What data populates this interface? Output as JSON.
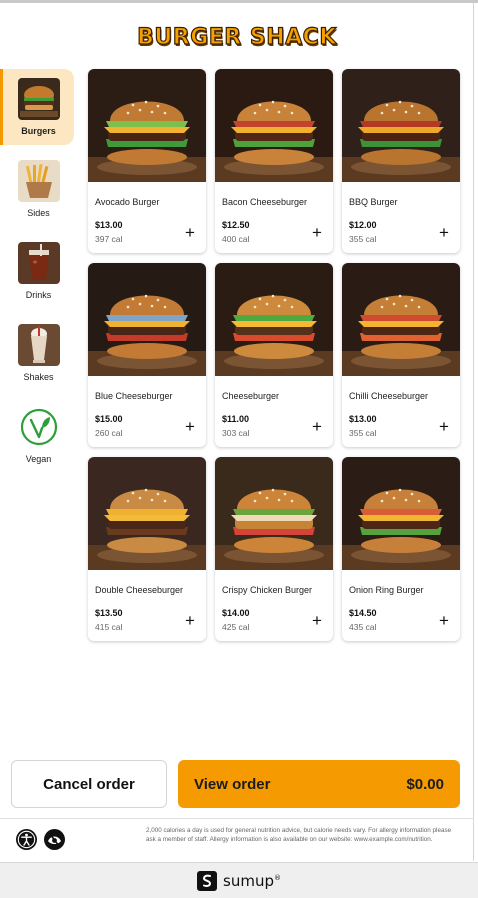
{
  "brand": {
    "title": "BURGER SHACK"
  },
  "categories": [
    {
      "label": "Burgers",
      "icon": "burger-icon",
      "active": true
    },
    {
      "label": "Sides",
      "icon": "fries-icon",
      "active": false
    },
    {
      "label": "Drinks",
      "icon": "drink-icon",
      "active": false
    },
    {
      "label": "Shakes",
      "icon": "shake-icon",
      "active": false
    },
    {
      "label": "Vegan",
      "icon": "vegan-leaf-icon",
      "active": false
    }
  ],
  "products": [
    {
      "name": "Avocado Burger",
      "price": "$13.00",
      "cal": "397 cal"
    },
    {
      "name": "Bacon Cheeseburger",
      "price": "$12.50",
      "cal": "400 cal"
    },
    {
      "name": "BBQ Burger",
      "price": "$12.00",
      "cal": "355 cal"
    },
    {
      "name": "Blue Cheeseburger",
      "price": "$15.00",
      "cal": "260 cal"
    },
    {
      "name": "Cheeseburger",
      "price": "$11.00",
      "cal": "303 cal"
    },
    {
      "name": "Chilli Cheeseburger",
      "price": "$13.00",
      "cal": "355 cal"
    },
    {
      "name": "Double Cheeseburger",
      "price": "$13.50",
      "cal": "415 cal"
    },
    {
      "name": "Crispy Chicken Burger",
      "price": "$14.00",
      "cal": "425 cal"
    },
    {
      "name": "Onion Ring Burger",
      "price": "$14.50",
      "cal": "435 cal"
    }
  ],
  "add_symbol": "+",
  "actions": {
    "cancel_label": "Cancel order",
    "view_label": "View order",
    "total": "$0.00"
  },
  "footer": {
    "note": "2,000 calories a day is used for general nutrition advice, but calorie needs vary. For allergy information please ask a member of staff. Allergy information is also available on our website: www.example.com/nutrition.",
    "brand": "sumup",
    "registered": "®"
  },
  "colors": {
    "accent": "#f59a00",
    "active_category_bg": "#fde7c3",
    "brand_title": "#f5a000"
  }
}
